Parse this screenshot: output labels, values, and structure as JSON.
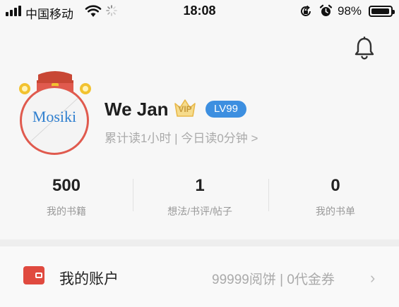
{
  "status_bar": {
    "carrier": "中国移动",
    "time": "18:08",
    "battery_percent": "98%",
    "battery_level": 0.98,
    "icons": [
      "signal-icon",
      "wifi-icon",
      "loading-icon",
      "rotation-lock-icon",
      "alarm-icon",
      "battery-icon"
    ]
  },
  "header": {
    "icons": [
      "bell-icon"
    ]
  },
  "profile": {
    "avatar_text": "Mosiki",
    "username": "We Jan",
    "vip_badge": "VIP",
    "level": "LV99",
    "reading_summary": "累计读1小时 | 今日读0分钟 >"
  },
  "stats": [
    {
      "value": "500",
      "label": "我的书籍"
    },
    {
      "value": "1",
      "label": "想法/书评/帖子"
    },
    {
      "value": "0",
      "label": "我的书单"
    }
  ],
  "account": {
    "title": "我的账户",
    "summary": "99999阅饼 | 0代金券",
    "icons": [
      "wallet-icon",
      "chevron-right-icon"
    ]
  },
  "colors": {
    "accent_blue": "#3d8fe0",
    "avatar_red": "#e05a4e",
    "vip_gold": "#e8b84a",
    "wallet_red": "#e04a3f"
  }
}
